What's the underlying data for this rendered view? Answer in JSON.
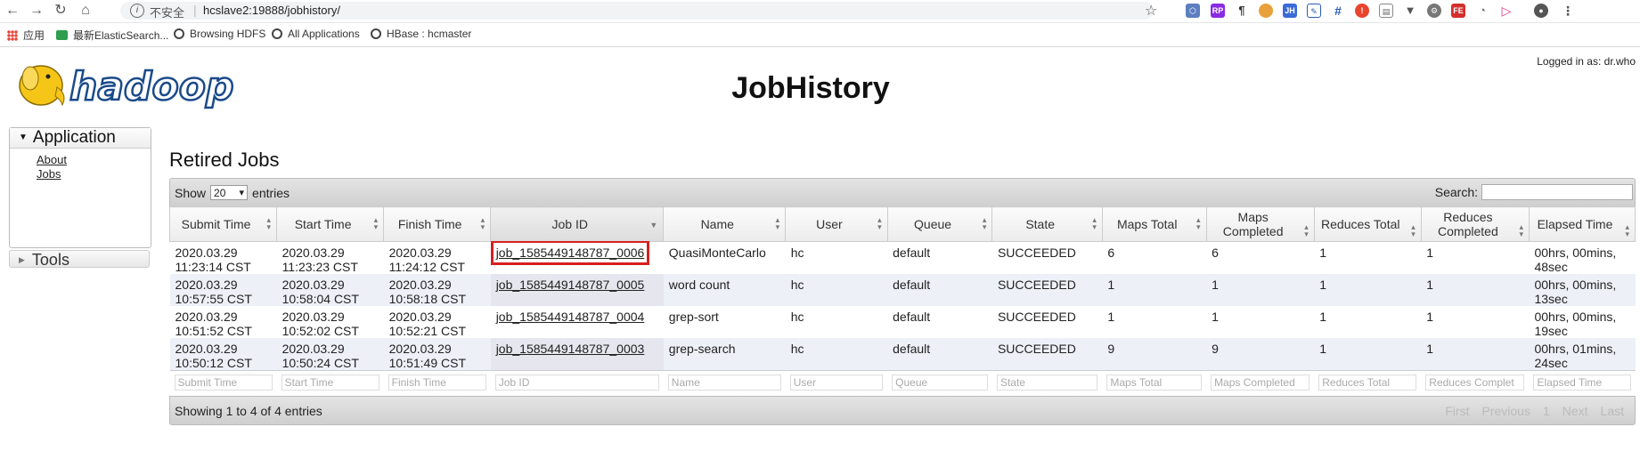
{
  "browser": {
    "insecure_label": "不安全",
    "url": "hcslave2:19888/jobhistory/",
    "bookmarks": [
      {
        "label": "应用"
      },
      {
        "label": "最新ElasticSearch..."
      },
      {
        "label": "Browsing HDFS"
      },
      {
        "label": "All Applications"
      },
      {
        "label": "HBase : hcmaster"
      }
    ]
  },
  "header": {
    "logo_text": "hadoop",
    "title": "JobHistory",
    "logged_in": "Logged in as: dr.who"
  },
  "sidebar": {
    "application_label": "Application",
    "links": [
      "About",
      "Jobs"
    ],
    "tools_label": "Tools"
  },
  "main": {
    "section_title": "Retired Jobs",
    "show_label": "Show",
    "page_size": "20",
    "entries_label": "entries",
    "search_label": "Search:",
    "columns": [
      "Submit Time",
      "Start Time",
      "Finish Time",
      "Job ID",
      "Name",
      "User",
      "Queue",
      "State",
      "Maps Total",
      "Maps Completed",
      "Reduces Total",
      "Reduces Completed",
      "Elapsed Time"
    ],
    "rows": [
      {
        "submit": "2020.03.29 11:23:14 CST",
        "start": "2020.03.29 11:23:23 CST",
        "finish": "2020.03.29 11:24:12 CST",
        "job_id": "job_1585449148787_0006",
        "name": "QuasiMonteCarlo",
        "user": "hc",
        "queue": "default",
        "state": "SUCCEEDED",
        "maps_total": "6",
        "maps_completed": "6",
        "reduces_total": "1",
        "reduces_completed": "1",
        "elapsed": "00hrs, 00mins, 48sec"
      },
      {
        "submit": "2020.03.29 10:57:55 CST",
        "start": "2020.03.29 10:58:04 CST",
        "finish": "2020.03.29 10:58:18 CST",
        "job_id": "job_1585449148787_0005",
        "name": "word count",
        "user": "hc",
        "queue": "default",
        "state": "SUCCEEDED",
        "maps_total": "1",
        "maps_completed": "1",
        "reduces_total": "1",
        "reduces_completed": "1",
        "elapsed": "00hrs, 00mins, 13sec"
      },
      {
        "submit": "2020.03.29 10:51:52 CST",
        "start": "2020.03.29 10:52:02 CST",
        "finish": "2020.03.29 10:52:21 CST",
        "job_id": "job_1585449148787_0004",
        "name": "grep-sort",
        "user": "hc",
        "queue": "default",
        "state": "SUCCEEDED",
        "maps_total": "1",
        "maps_completed": "1",
        "reduces_total": "1",
        "reduces_completed": "1",
        "elapsed": "00hrs, 00mins, 19sec"
      },
      {
        "submit": "2020.03.29 10:50:12 CST",
        "start": "2020.03.29 10:50:24 CST",
        "finish": "2020.03.29 10:51:49 CST",
        "job_id": "job_1585449148787_0003",
        "name": "grep-search",
        "user": "hc",
        "queue": "default",
        "state": "SUCCEEDED",
        "maps_total": "9",
        "maps_completed": "9",
        "reduces_total": "1",
        "reduces_completed": "1",
        "elapsed": "00hrs, 01mins, 24sec"
      }
    ],
    "filters": [
      "Submit Time",
      "Start Time",
      "Finish Time",
      "Job ID",
      "Name",
      "User",
      "Queue",
      "State",
      "Maps Total",
      "Maps Completed",
      "Reduces Total",
      "Reduces Complet",
      "Elapsed Time"
    ],
    "info": "Showing 1 to 4 of 4 entries",
    "pager": [
      "First",
      "Previous",
      "1",
      "Next",
      "Last"
    ]
  },
  "colors": {
    "highlight": "#d71f1f",
    "logo_yellow": "#f5c518",
    "logo_blue": "#1a4a8a"
  }
}
